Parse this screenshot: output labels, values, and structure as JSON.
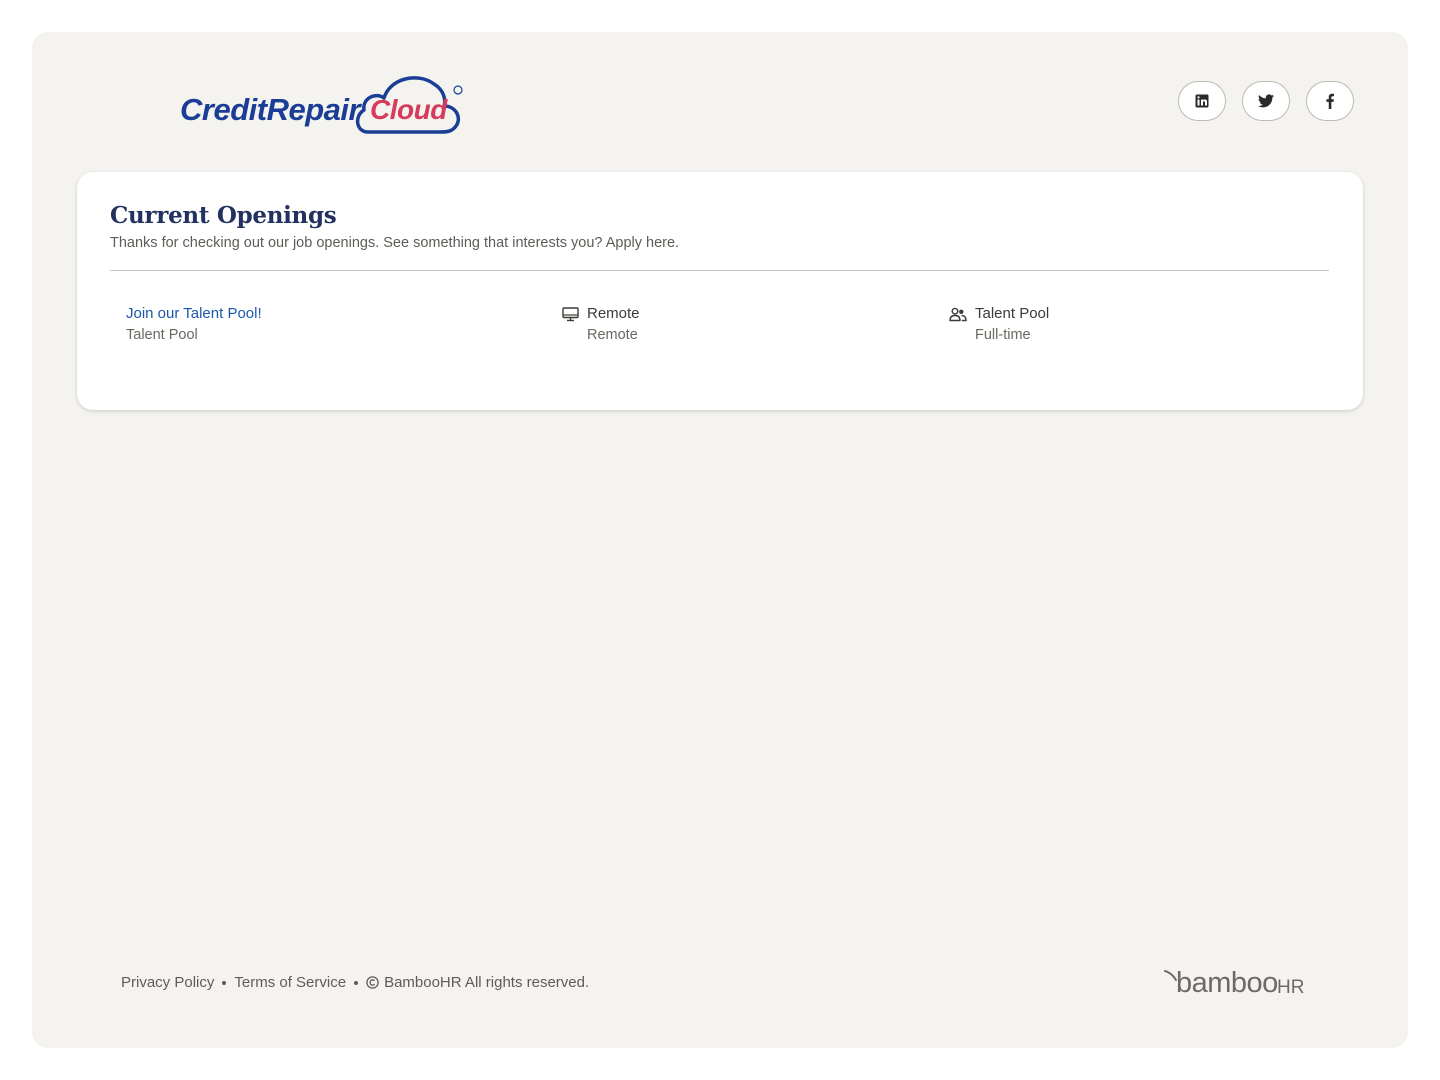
{
  "header": {
    "logo": {
      "brand": "CreditRepair",
      "brand_accent": "Cloud",
      "registered_mark": "®"
    },
    "socials": [
      {
        "label": "LinkedIn",
        "icon": "linkedin-icon"
      },
      {
        "label": "Twitter",
        "icon": "twitter-icon"
      },
      {
        "label": "Facebook",
        "icon": "facebook-icon"
      }
    ]
  },
  "openings": {
    "title": "Current Openings",
    "subtitle": "Thanks for checking out our job openings. See something that interests you? Apply here.",
    "jobs": [
      {
        "title": "Join our Talent Pool!",
        "department": "Talent Pool",
        "location_label": "Remote",
        "location_sub": "Remote",
        "location_icon": "monitor-icon",
        "type_label": "Talent Pool",
        "type_sub": "Full-time",
        "type_icon": "people-icon"
      }
    ]
  },
  "footer": {
    "privacy": "Privacy Policy",
    "terms": "Terms of Service",
    "copyright": "BambooHR All rights reserved.",
    "powered_by": "bamboo",
    "powered_by_suffix": "HR"
  },
  "colors": {
    "page_bg": "#f5f3f0",
    "card_bg": "#ffffff",
    "title": "#22315f",
    "link": "#1c57a8",
    "brand_blue": "#1a3d96",
    "brand_pink": "#d63a5c"
  }
}
